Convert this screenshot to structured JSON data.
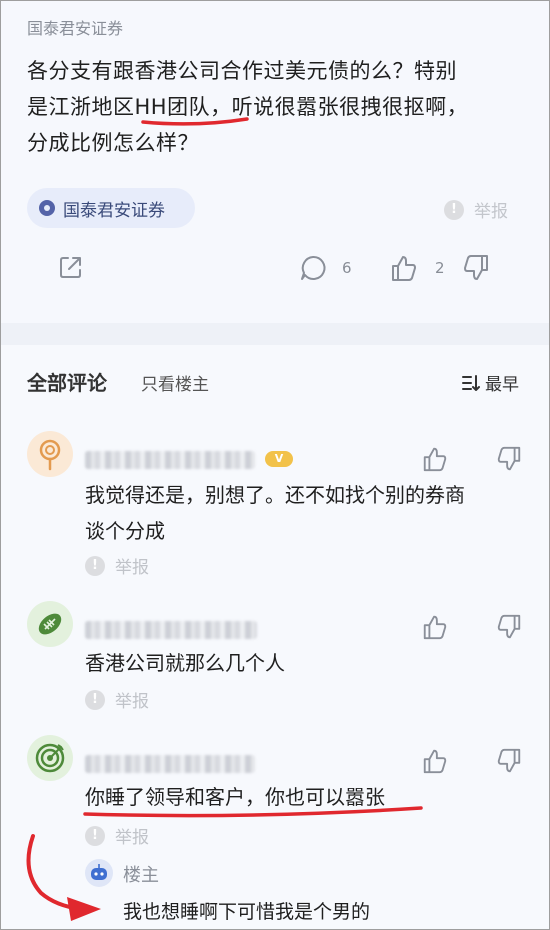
{
  "post": {
    "source": "国泰君安证券",
    "body_line1": "各分支有跟香港公司合作过美元债的么？特别",
    "body_line2_a": "是江浙地区",
    "body_line2_b": "HH团队，",
    "body_line2_c": "听说很嚣张很拽很抠啊，",
    "body_line3": "分成比例怎么样？",
    "tag": "国泰君安证券",
    "report_label": "举报",
    "comment_count": "6",
    "like_count": "2"
  },
  "comments_header": {
    "title": "全部评论",
    "filter_label": "只看楼主",
    "sort_label": "最早"
  },
  "comments": [
    {
      "text_line1": "我觉得还是，别想了。还不如找个别的券商",
      "text_line2": "谈个分成",
      "report_label": "举报",
      "badge": "V"
    },
    {
      "text_line1": "香港公司就那么几个人",
      "report_label": "举报"
    },
    {
      "text_line1": "你睡了领导和客户，你也可以嚣张",
      "report_label": "举报",
      "reply": {
        "label": "楼主",
        "text": "我也想睡啊下可惜我是个男的"
      }
    }
  ],
  "colors": {
    "accent_red": "#e0282e",
    "tag_bg": "#e7ecfa",
    "vip_gold": "#f2c24a"
  },
  "icons": {
    "share": "share-icon",
    "comment": "comment-icon",
    "like": "thumbs-up-icon",
    "dislike": "thumbs-down-icon",
    "report": "warning-icon",
    "sort": "sort-icon"
  }
}
